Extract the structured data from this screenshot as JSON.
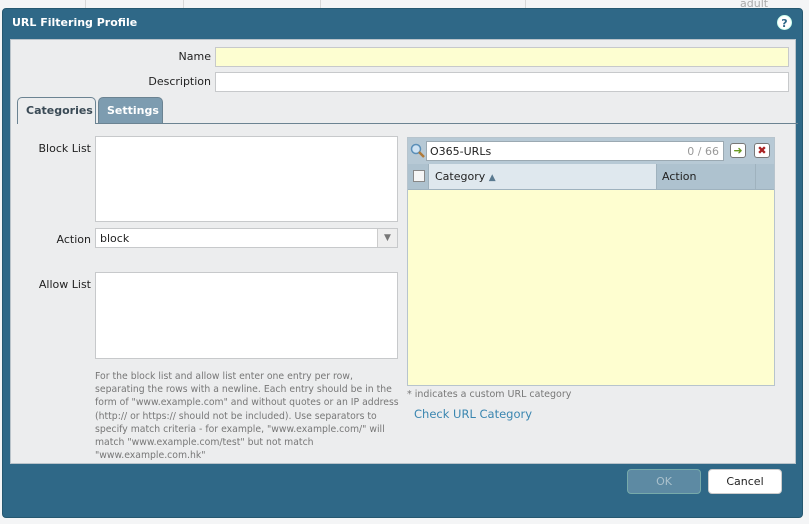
{
  "background": {
    "text": "adult"
  },
  "dialog": {
    "title": "URL Filtering Profile",
    "help_icon": "?"
  },
  "form": {
    "name_label": "Name",
    "name_value": "",
    "description_label": "Description",
    "description_value": ""
  },
  "tabs": [
    {
      "label": "Categories",
      "active": true
    },
    {
      "label": "Settings",
      "active": false
    }
  ],
  "categories": {
    "block_list_label": "Block List",
    "action_label": "Action",
    "action_value": "block",
    "allow_list_label": "Allow List",
    "hint": "For the block list and allow list enter one entry per row, separating the rows with a newline. Each entry should be in the form of \"www.example.com\" and without quotes or an IP address (http:// or https:// should not be included). Use separators to specify match criteria - for example, \"www.example.com/\" will match \"www.example.com/test\" but not match \"www.example.com.hk\"",
    "search_value": "O365-URLs",
    "search_count": "0 / 66",
    "columns": [
      "Category",
      "Action"
    ],
    "note": "* indicates a custom URL category",
    "check_link": "Check URL Category"
  },
  "footer": {
    "ok": "OK",
    "cancel": "Cancel"
  }
}
